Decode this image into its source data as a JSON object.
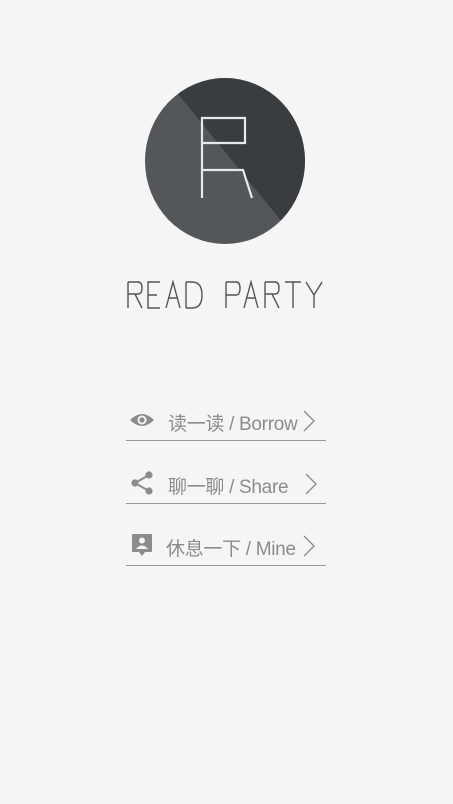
{
  "brand": {
    "name": "READ PARTY",
    "logo_letter": "R",
    "colors": {
      "circle_light": "#55565a",
      "circle_dark": "#3b3c40",
      "logo_stroke": "#e8e8e8",
      "brand_text": "#555555"
    }
  },
  "menu": {
    "items": [
      {
        "label": "读一读 / Borrow",
        "icon": "eye-icon"
      },
      {
        "label": "聊一聊 / Share",
        "icon": "share-icon"
      },
      {
        "label": "休息一下 / Mine",
        "icon": "profile-card-icon"
      }
    ],
    "text_color": "#8c8c8c",
    "divider_color": "#9a9a9a"
  },
  "background_color": "#f5f5f5"
}
